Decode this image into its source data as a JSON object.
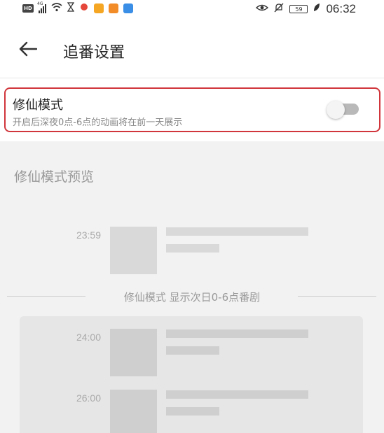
{
  "status_bar": {
    "network_type": "4G",
    "hd_label": "HD",
    "battery_level": "59",
    "time": "06:32"
  },
  "header": {
    "title": "追番设置",
    "back_icon": "arrow-left-icon"
  },
  "setting": {
    "title": "修仙模式",
    "description": "开启后深夜0点-6点的动画将在前一天展示",
    "toggle_on": false
  },
  "preview": {
    "title": "修仙模式预览",
    "before_slots": [
      {
        "time": "23:59"
      }
    ],
    "divider_text": "修仙模式 显示次日0-6点番剧",
    "night_slots": [
      {
        "time": "24:00"
      },
      {
        "time": "26:00"
      }
    ]
  },
  "colors": {
    "highlight_border": "#d0363c",
    "toggle_track_off": "#b9b9b9",
    "placeholder": "#d9d9d9"
  }
}
